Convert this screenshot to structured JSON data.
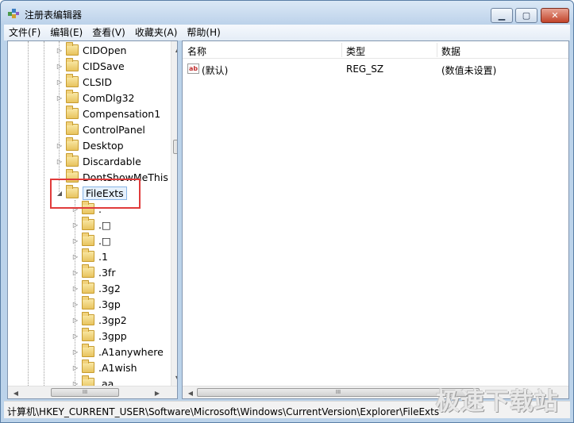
{
  "window": {
    "title": "注册表编辑器",
    "minimize": "▁",
    "maximize": "▢",
    "close": "✕"
  },
  "menu": [
    "文件(F)",
    "编辑(E)",
    "查看(V)",
    "收藏夹(A)",
    "帮助(H)"
  ],
  "tree": {
    "items": [
      {
        "label": "CIDOpen",
        "expander": "▷"
      },
      {
        "label": "CIDSave",
        "expander": "▷"
      },
      {
        "label": "CLSID",
        "expander": "▷"
      },
      {
        "label": "ComDlg32",
        "expander": "▷"
      },
      {
        "label": "Compensation1",
        "expander": ""
      },
      {
        "label": "ControlPanel",
        "expander": ""
      },
      {
        "label": "Desktop",
        "expander": "▷"
      },
      {
        "label": "Discardable",
        "expander": "▷"
      },
      {
        "label": "DontShowMeThis",
        "expander": ""
      },
      {
        "label": "FileExts",
        "expander": "◢",
        "selected": true
      }
    ],
    "children": [
      {
        "label": ".",
        "expander": "▷"
      },
      {
        "label": ".□",
        "expander": "▷"
      },
      {
        "label": ".□",
        "expander": "▷"
      },
      {
        "label": ".1",
        "expander": "▷"
      },
      {
        "label": ".3fr",
        "expander": "▷"
      },
      {
        "label": ".3g2",
        "expander": "▷"
      },
      {
        "label": ".3gp",
        "expander": "▷"
      },
      {
        "label": ".3gp2",
        "expander": "▷"
      },
      {
        "label": ".3gpp",
        "expander": "▷"
      },
      {
        "label": ".A1anywhere",
        "expander": "▷"
      },
      {
        "label": ".A1wish",
        "expander": "▷"
      },
      {
        "label": ".aa",
        "expander": "▷"
      }
    ]
  },
  "list": {
    "columns": [
      "名称",
      "类型",
      "数据"
    ],
    "rows": [
      {
        "icon": "ab",
        "name": "(默认)",
        "type": "REG_SZ",
        "data": "(数值未设置)"
      }
    ]
  },
  "scroll": {
    "up": "▲",
    "down": "▼",
    "left": "◀",
    "right": "▶",
    "grip": "III"
  },
  "status": "计算机\\HKEY_CURRENT_USER\\Software\\Microsoft\\Windows\\CurrentVersion\\Explorer\\FileExts",
  "watermark": "极速下载站",
  "colors": {
    "highlight_box": "#e03b3b",
    "title_bar": "#bcd2ea"
  }
}
